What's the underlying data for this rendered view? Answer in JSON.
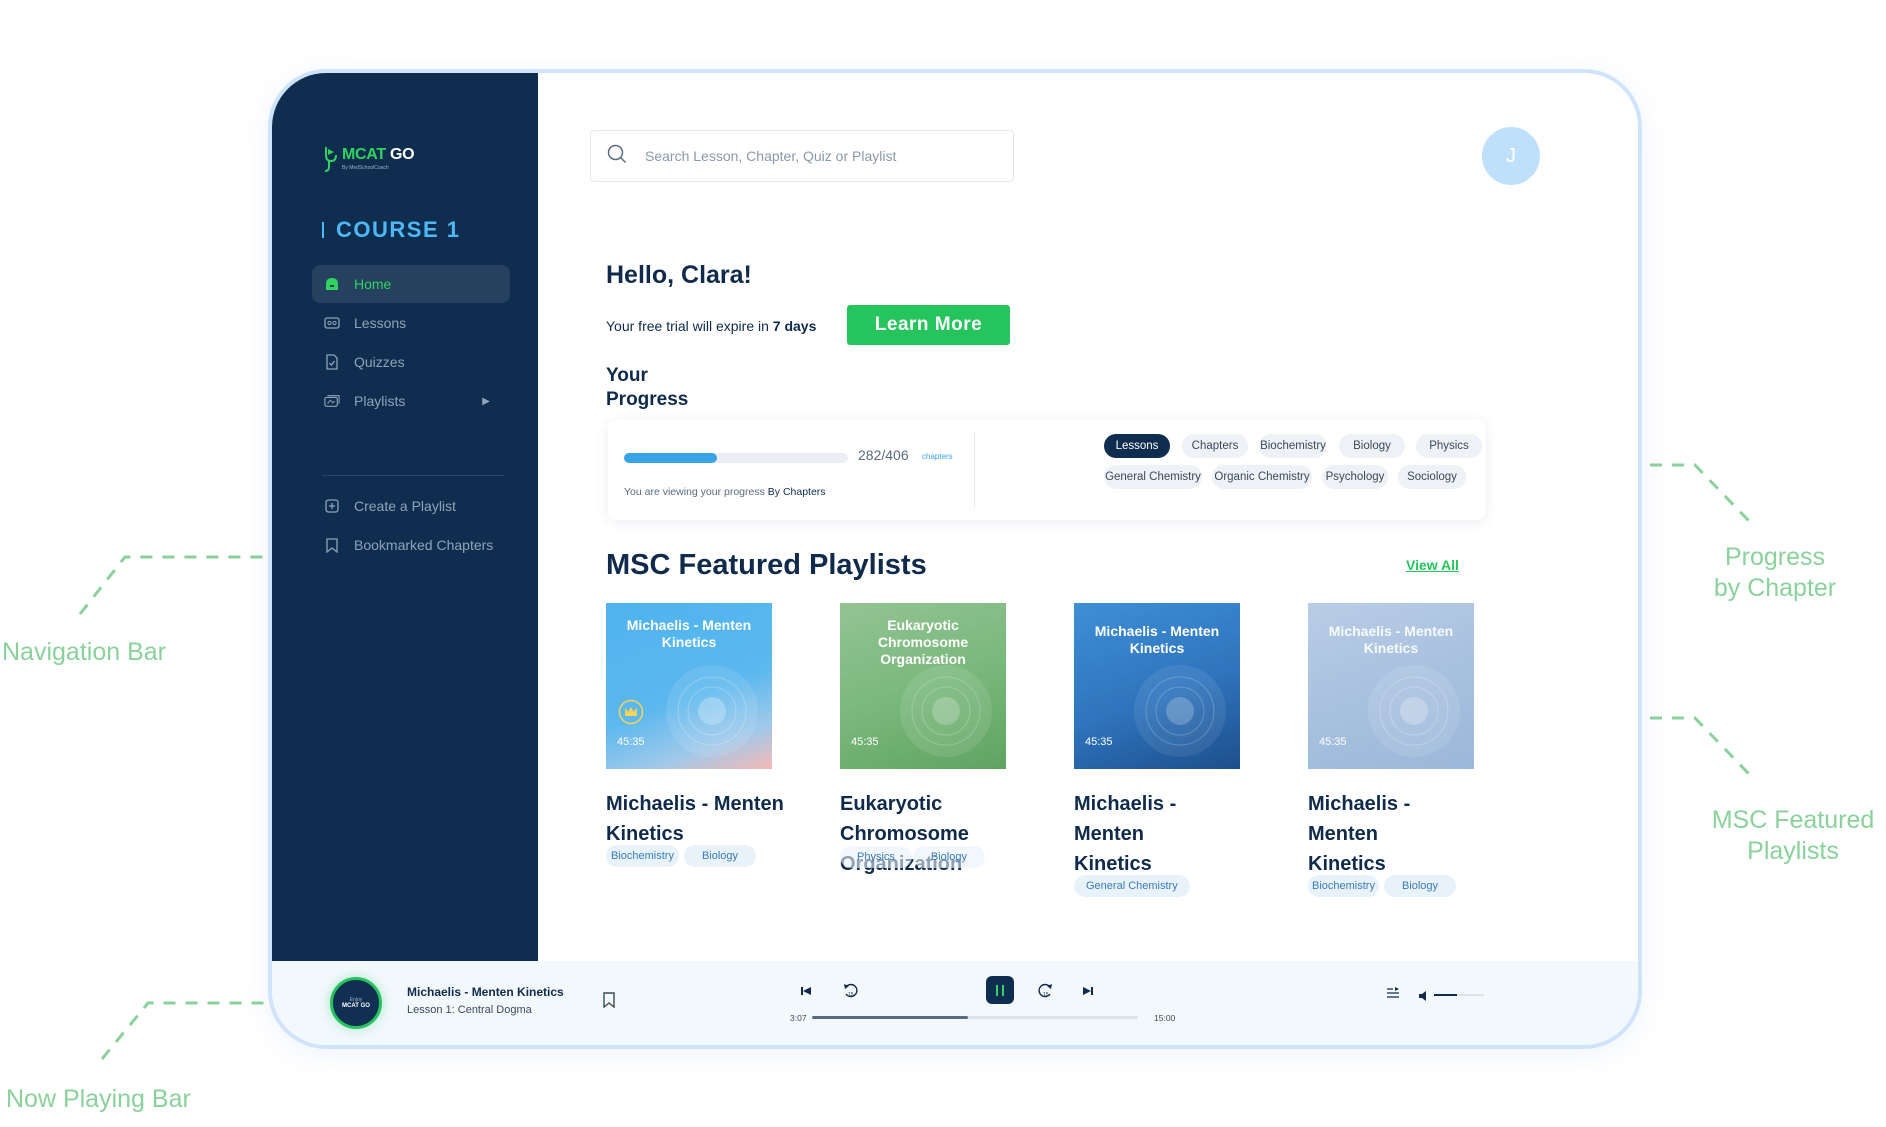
{
  "annotations": {
    "navigation_bar": "Navigation Bar",
    "progress_by_chapter": "Progress\nby Chapter",
    "featured_playlists": "MSC Featured\nPlaylists",
    "now_playing_bar": "Now Playing Bar"
  },
  "logo": {
    "mcat": "MCAT",
    "go": " GO",
    "tagline": "By MedSchoolCoach"
  },
  "sidebar": {
    "course": "COURSE 1",
    "items": [
      {
        "label": "Home",
        "icon": "home-icon",
        "active": true
      },
      {
        "label": "Lessons",
        "icon": "lessons-icon"
      },
      {
        "label": "Quizzes",
        "icon": "quiz-icon"
      },
      {
        "label": "Playlists",
        "icon": "playlist-icon"
      },
      {
        "label": "Create a Playlist",
        "icon": "plus-square-icon"
      },
      {
        "label": "Bookmarked Chapters",
        "icon": "bookmark-icon"
      }
    ]
  },
  "search": {
    "placeholder": "Search Lesson, Chapter, Quiz or Playlist"
  },
  "user": {
    "initial": "J"
  },
  "greeting": {
    "hello": "Hello, Clara!",
    "trial_prefix": "Your free trial will expire in ",
    "trial_days": "7 days",
    "learn_more": "Learn More"
  },
  "progress": {
    "title": "Your Progress",
    "count": "282/406",
    "unit": "chapters",
    "completed": 282,
    "total": 406,
    "note_prefix": "You are viewing your progress ",
    "note_mode": "By Chapters",
    "chips_row1": [
      "Lessons",
      "Chapters",
      "Biochemistry",
      "Biology",
      "Physics"
    ],
    "chips_row2": [
      "General Chemistry",
      "Organic  Chemistry",
      "Psychology",
      "Sociology"
    ],
    "active_chip": "Lessons"
  },
  "featured": {
    "title": "MSC Featured Playlists",
    "view_all": "View All",
    "playlists": [
      {
        "thumb_title": "Michaelis - Menten Kinetics",
        "duration": "45:35",
        "name": "Michaelis - Menten Kinetics",
        "tags": [
          "Biochemistry",
          "Biology"
        ],
        "premium": true
      },
      {
        "thumb_title": "Eukaryotic Chromosome Organization",
        "duration": "45:35",
        "name": "Eukaryotic Chromosome Organization",
        "tags": [
          "Physics",
          "Biology"
        ]
      },
      {
        "thumb_title": "Michaelis - Menten Kinetics",
        "duration": "45:35",
        "name": "Michaelis - Menten Kinetics",
        "tags": [
          "General Chemistry"
        ]
      },
      {
        "thumb_title": "Michaelis - Menten Kinetics",
        "duration": "45:35",
        "name": "Michaelis - Menten Kinetics",
        "tags": [
          "Biochemistry",
          "Biology"
        ]
      }
    ]
  },
  "player": {
    "art_line1": "Enjoy",
    "art_line2": "MCAT GO",
    "title": "Michaelis - Menten Kinetics",
    "subtitle": "Lesson 1: Central Dogma",
    "elapsed": "3:07",
    "total": "15:00",
    "progress": 0.48,
    "rewind_seconds": "15",
    "forward_seconds": "15",
    "volume": 0.45
  },
  "colors": {
    "sidebar": "#0f2e4f",
    "accent_green": "#25c45c",
    "accent_blue": "#4db8f5",
    "annotation": "#8ad19b"
  }
}
